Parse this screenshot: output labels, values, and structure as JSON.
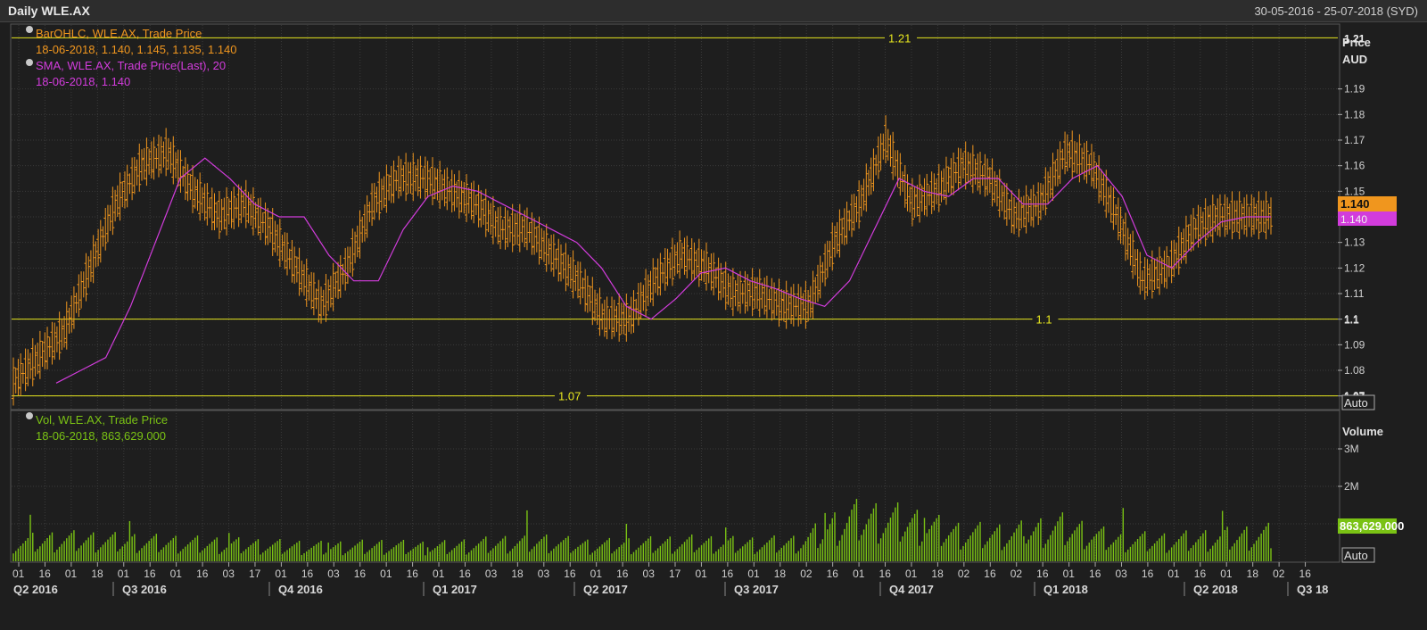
{
  "header": {
    "title": "Daily WLE.AX",
    "date_range": "30-05-2016 - 25-07-2018 (SYD)"
  },
  "price_panel": {
    "axis_title_1": "Price",
    "axis_title_2": "AUD",
    "legend": [
      {
        "label": "BarOHLC, WLE.AX, Trade Price",
        "value": "18-06-2018, 1.140, 1.145, 1.135, 1.140",
        "color": "#f0961e"
      },
      {
        "label": "SMA, WLE.AX, Trade Price(Last),  20",
        "value": "18-06-2018, 1.140",
        "color": "#d23cdc"
      }
    ],
    "last_price_tag": "1.140",
    "sma_tag": "1.140",
    "auto_button": "Auto"
  },
  "volume_panel": {
    "axis_title": "Volume",
    "legend_label": "Vol, WLE.AX, Trade Price",
    "legend_value": "18-06-2018, 863,629.000",
    "last_volume_tag": "863,629.000",
    "auto_button": "Auto",
    "color": "#7ac214"
  },
  "colors": {
    "background": "#1e1e1e",
    "grid": "#3a3a3a",
    "price_bars": "#f0961e",
    "sma": "#d23cdc",
    "reference_lines": "#e6e61e",
    "volume": "#7ac214"
  },
  "chart_data": [
    {
      "type": "line",
      "title": "Daily WLE.AX",
      "ylabel": "Price AUD",
      "ylim": [
        1.065,
        1.215
      ],
      "yticks": [
        "1.07",
        "1.08",
        "1.09",
        "1.1",
        "1.11",
        "1.12",
        "1.13",
        "1.14",
        "1.15",
        "1.16",
        "1.17",
        "1.18",
        "1.19"
      ],
      "reference_lines": [
        {
          "label": "1.21",
          "value": 1.21
        },
        {
          "label": "1.1",
          "value": 1.1
        },
        {
          "label": "1.07",
          "value": 1.07
        }
      ],
      "x": [
        "2016-05-30",
        "2016-06-15",
        "2016-07-01",
        "2016-07-15",
        "2016-08-01",
        "2016-08-15",
        "2016-09-01",
        "2016-09-15",
        "2016-10-01",
        "2016-10-15",
        "2016-11-01",
        "2016-11-15",
        "2016-12-01",
        "2016-12-15",
        "2017-01-01",
        "2017-01-15",
        "2017-02-01",
        "2017-02-15",
        "2017-03-01",
        "2017-03-15",
        "2017-04-01",
        "2017-04-15",
        "2017-05-01",
        "2017-05-15",
        "2017-06-01",
        "2017-06-15",
        "2017-07-01",
        "2017-07-15",
        "2017-08-01",
        "2017-08-15",
        "2017-09-01",
        "2017-09-15",
        "2017-10-01",
        "2017-10-15",
        "2017-11-01",
        "2017-11-15",
        "2017-12-01",
        "2017-12-15",
        "2018-01-01",
        "2018-01-15",
        "2018-02-01",
        "2018-02-15",
        "2018-03-01",
        "2018-03-15",
        "2018-04-01",
        "2018-04-15",
        "2018-05-01",
        "2018-05-15",
        "2018-06-01",
        "2018-06-18"
      ],
      "series": [
        {
          "name": "BarOHLC, WLE.AX, Trade Price",
          "values": [
            1.075,
            1.085,
            1.095,
            1.12,
            1.145,
            1.16,
            1.165,
            1.15,
            1.14,
            1.145,
            1.135,
            1.12,
            1.105,
            1.12,
            1.145,
            1.155,
            1.155,
            1.15,
            1.145,
            1.135,
            1.135,
            1.125,
            1.115,
            1.1,
            1.1,
            1.115,
            1.125,
            1.12,
            1.11,
            1.11,
            1.105,
            1.105,
            1.13,
            1.145,
            1.17,
            1.145,
            1.15,
            1.16,
            1.155,
            1.14,
            1.145,
            1.165,
            1.16,
            1.14,
            1.115,
            1.12,
            1.135,
            1.14,
            1.14,
            1.14
          ]
        },
        {
          "name": "SMA, WLE.AX, Trade Price(Last),  20",
          "values": [
            1.075,
            1.08,
            1.085,
            1.105,
            1.13,
            1.155,
            1.163,
            1.155,
            1.145,
            1.14,
            1.14,
            1.125,
            1.115,
            1.115,
            1.135,
            1.148,
            1.152,
            1.15,
            1.145,
            1.14,
            1.135,
            1.13,
            1.12,
            1.105,
            1.1,
            1.108,
            1.118,
            1.12,
            1.115,
            1.112,
            1.108,
            1.105,
            1.115,
            1.135,
            1.155,
            1.15,
            1.148,
            1.155,
            1.155,
            1.145,
            1.145,
            1.155,
            1.16,
            1.148,
            1.125,
            1.12,
            1.13,
            1.138,
            1.14,
            1.14
          ]
        }
      ]
    },
    {
      "type": "bar",
      "title": "Vol, WLE.AX, Trade Price",
      "ylabel": "Volume",
      "ylim": [
        0,
        4000000
      ],
      "yticks": [
        "1M",
        "2M",
        "3M"
      ],
      "categories": [
        "2016-06",
        "2016-07",
        "2016-08",
        "2016-09",
        "2016-10",
        "2016-11",
        "2016-12",
        "2017-01",
        "2017-02",
        "2017-03",
        "2017-04",
        "2017-05",
        "2017-06",
        "2017-07",
        "2017-08",
        "2017-09",
        "2017-10",
        "2017-11",
        "2017-12",
        "2018-01",
        "2018-02",
        "2018-03",
        "2018-04",
        "2018-05",
        "2018-06"
      ],
      "values": [
        600000,
        700000,
        650000,
        600000,
        550000,
        500000,
        450000,
        500000,
        450000,
        550000,
        650000,
        500000,
        550000,
        600000,
        550000,
        600000,
        1400000,
        1300000,
        900000,
        850000,
        1100000,
        700000,
        650000,
        750000,
        863629
      ]
    }
  ],
  "x_axis": {
    "day_ticks": [
      "01",
      "16",
      "01",
      "18",
      "01",
      "16",
      "01",
      "16",
      "03",
      "17",
      "01",
      "16",
      "03",
      "16",
      "01",
      "16",
      "01",
      "16",
      "03",
      "18",
      "03",
      "16",
      "01",
      "16",
      "03",
      "17",
      "01",
      "16",
      "01",
      "18",
      "02",
      "16",
      "01",
      "16",
      "01",
      "18",
      "02",
      "16",
      "02",
      "16",
      "01",
      "16",
      "03",
      "16",
      "01",
      "16",
      "01",
      "18",
      "02",
      "16"
    ],
    "quarter_labels": [
      "Q2 2016",
      "Q3 2016",
      "Q4 2016",
      "Q1 2017",
      "Q2 2017",
      "Q3 2017",
      "Q4 2017",
      "Q1 2018",
      "Q2 2018",
      "Q3 18"
    ]
  }
}
